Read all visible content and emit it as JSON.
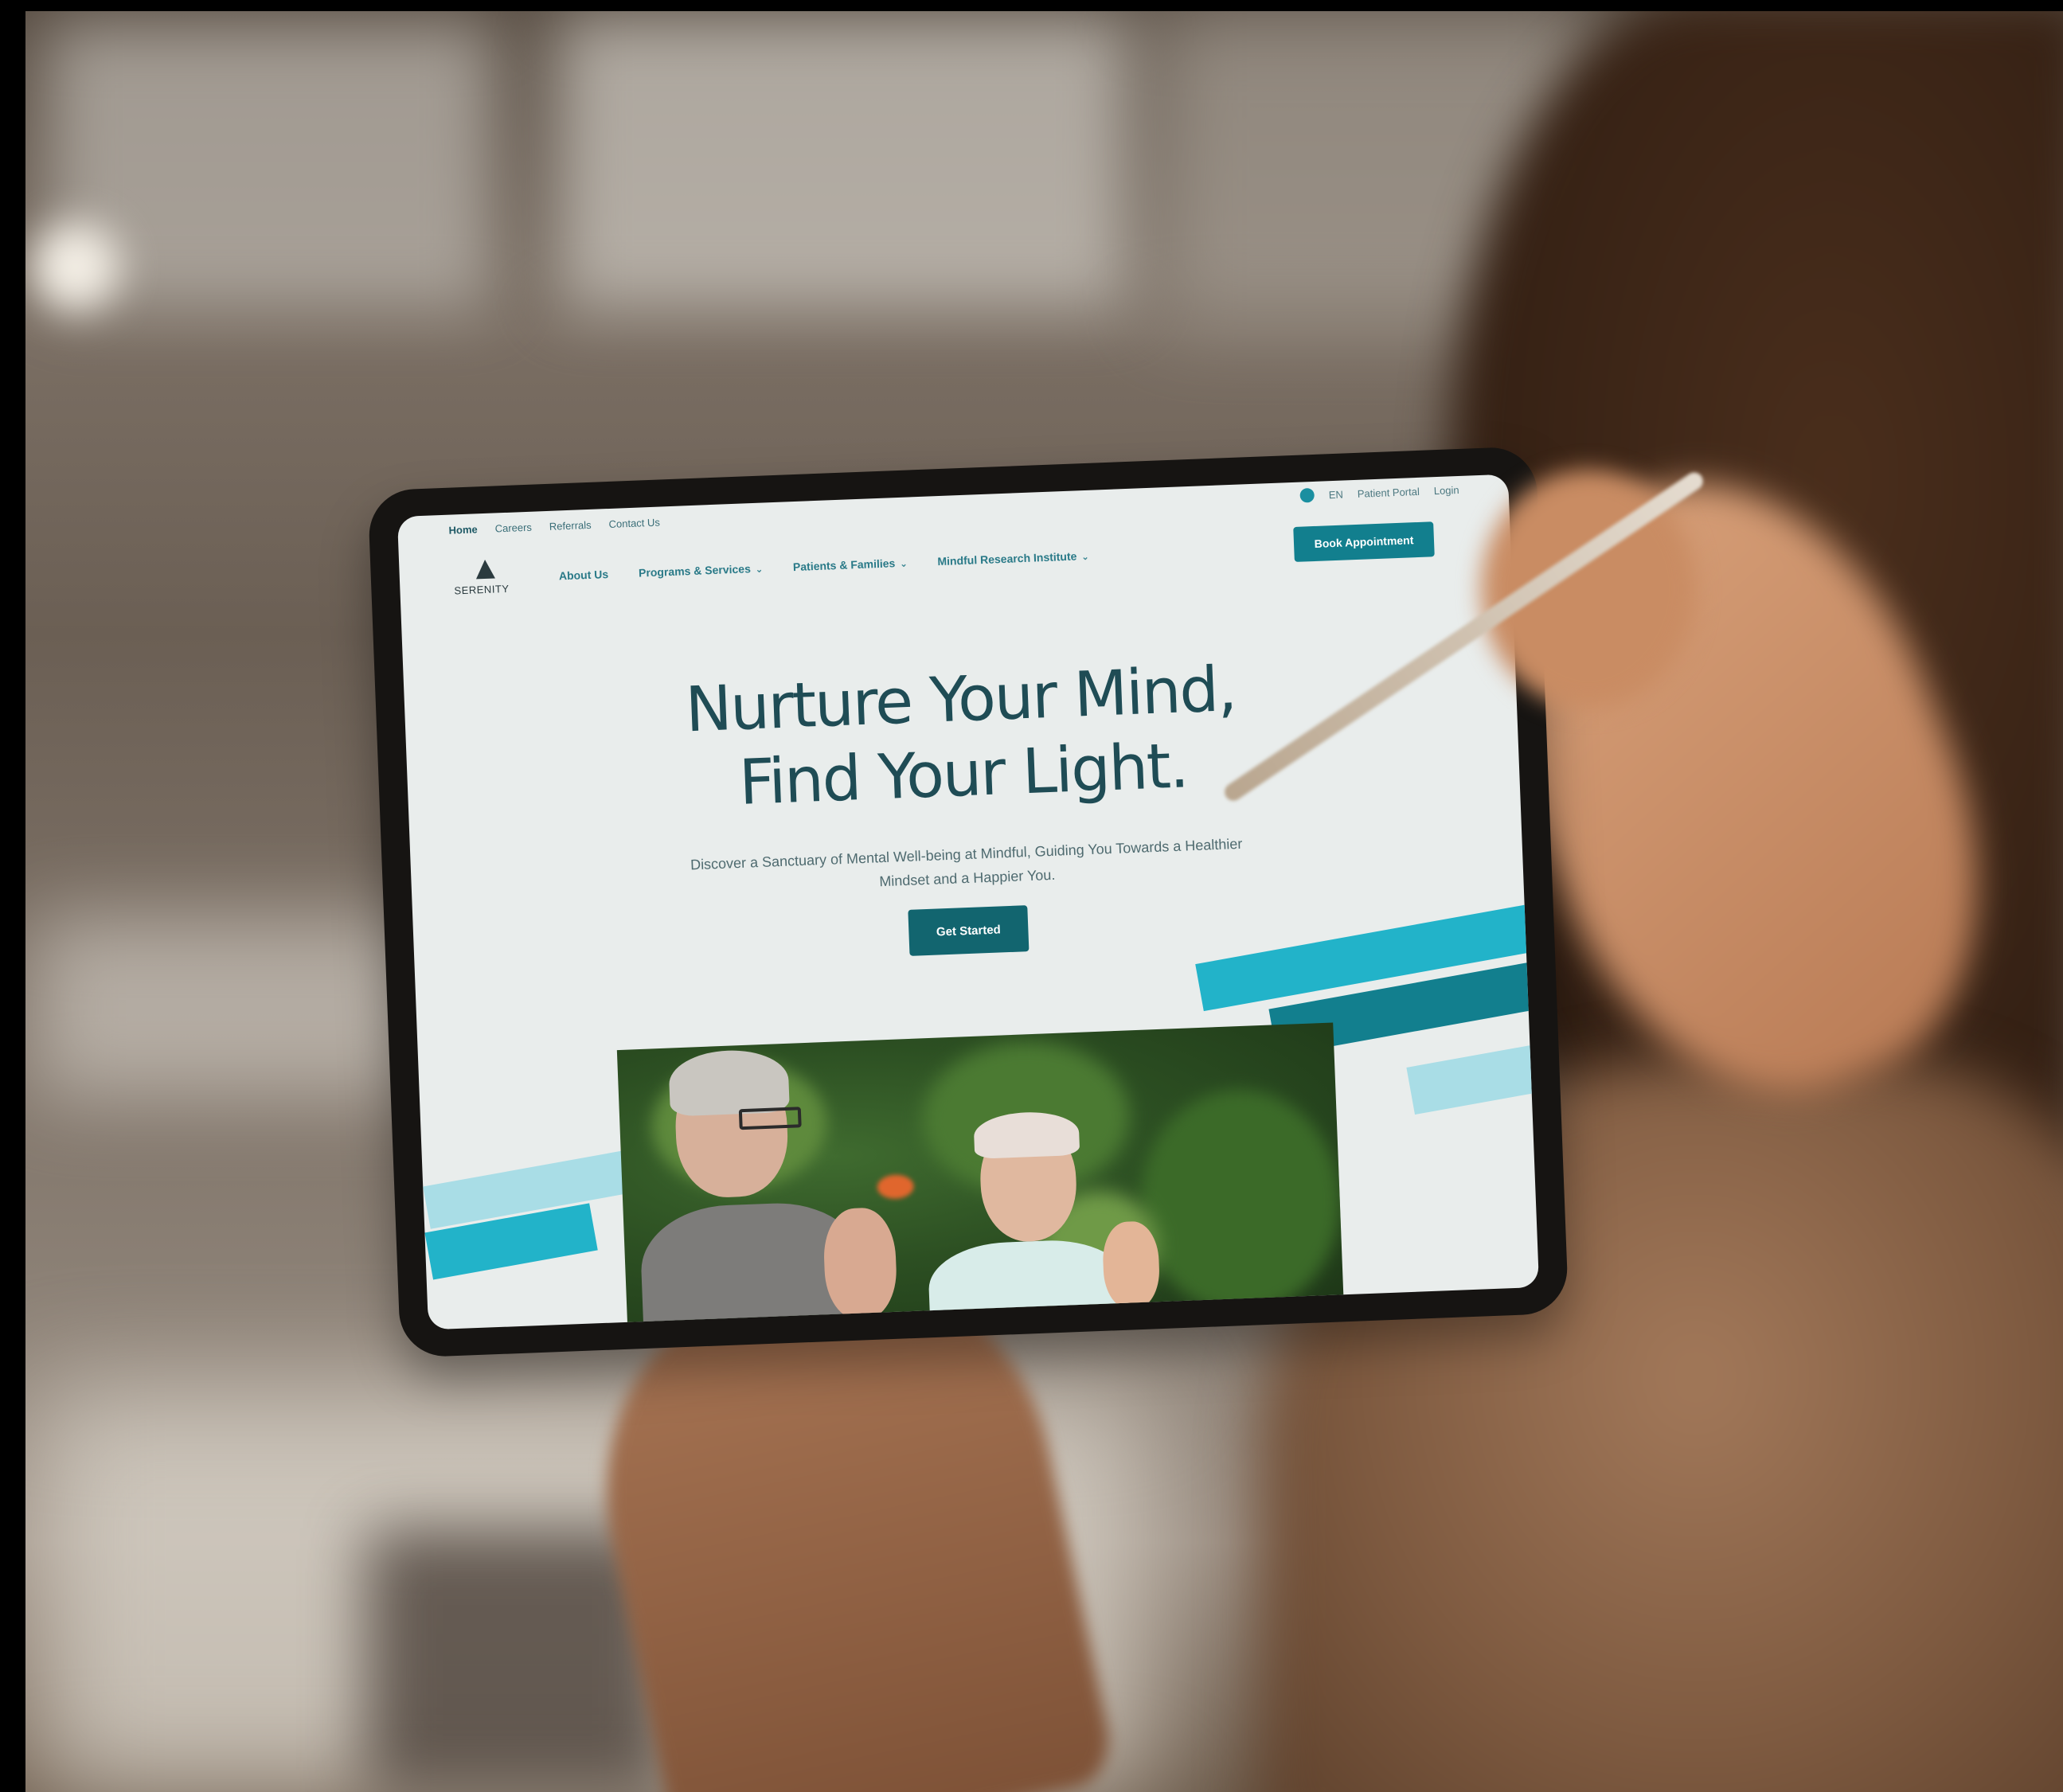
{
  "site": {
    "logo_text": "SERENITY",
    "utility_links": [
      "Home",
      "Careers",
      "Referrals",
      "Contact Us"
    ],
    "language": "EN",
    "account_links": [
      "Patient Portal",
      "Login"
    ],
    "nav": [
      {
        "label": "About Us",
        "has_dropdown": false
      },
      {
        "label": "Programs & Services",
        "has_dropdown": true
      },
      {
        "label": "Patients & Families",
        "has_dropdown": true
      },
      {
        "label": "Mindful Research Institute",
        "has_dropdown": true
      }
    ],
    "book_button": "Book Appointment",
    "hero": {
      "title_line1": "Nurture Your Mind,",
      "title_line2": "Find Your Light.",
      "subtitle": "Discover a Sanctuary of Mental Well-being at Mindful, Guiding You Towards a Healthier Mindset and a Happier You.",
      "cta": "Get Started"
    }
  },
  "colors": {
    "accent": "#127f8e",
    "accent_light": "#22b3c9",
    "accent_pale": "#a9dde6",
    "heading": "#1f4c55",
    "page_bg": "#e9edec"
  },
  "icons": {
    "language": "globe-icon",
    "dropdown": "chevron-down-icon"
  }
}
